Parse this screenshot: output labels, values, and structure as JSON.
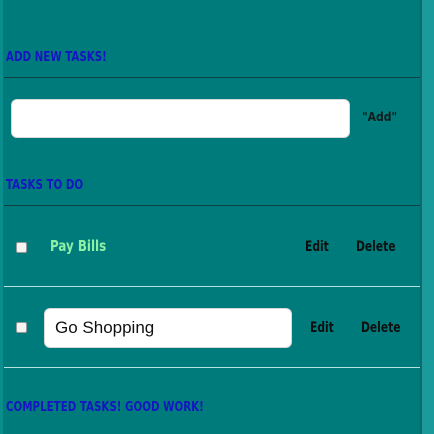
{
  "add_section": {
    "heading": "ADD NEW TASKS!",
    "input_value": "",
    "add_label": "\"Add\""
  },
  "todo_section": {
    "heading": "TASKS TO DO",
    "tasks": [
      {
        "label": "Pay Bills",
        "checked": false,
        "editing": false,
        "edit_label": "Edit",
        "delete_label": "Delete"
      },
      {
        "label": "Go Shopping",
        "checked": false,
        "editing": true,
        "edit_label": "Edit",
        "delete_label": "Delete"
      }
    ]
  },
  "completed_section": {
    "heading": "COMPLETED TASKS! GOOD WORK!"
  },
  "colors": {
    "panel_bg": "#007b7b",
    "heading": "#1515c4",
    "task_label": "#8df0a4",
    "action_text": "#0e1010"
  }
}
